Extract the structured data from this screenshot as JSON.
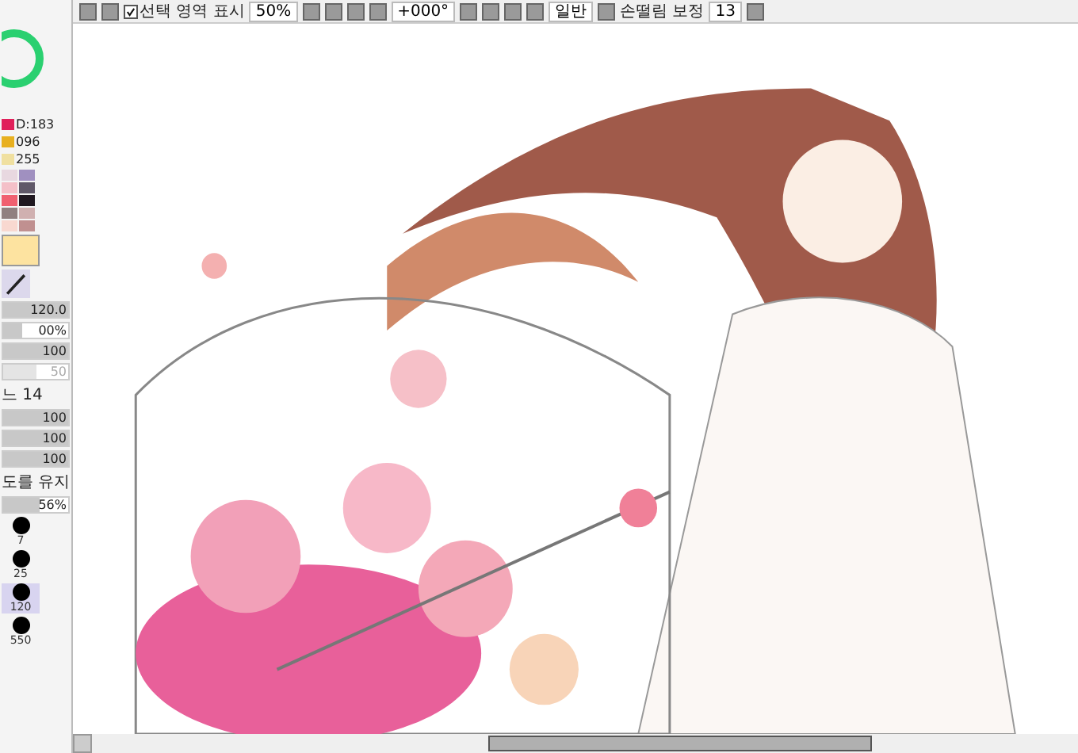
{
  "toolbar": {
    "selection_display": {
      "label": "선택 영역 표시",
      "checked": true
    },
    "zoom": "50%",
    "rotation": "+000°",
    "blend_mode": "일반",
    "stabilizer": {
      "label": "손떨림 보정",
      "value": "13"
    }
  },
  "color_values": [
    {
      "text": "D:183",
      "color": "#e0205a"
    },
    {
      "text": "096",
      "color": "#e8b020"
    },
    {
      "text": "255",
      "color": "#f0e0a0"
    }
  ],
  "tool_settings": [
    {
      "kind": "slider",
      "text": "120.0",
      "level": 1,
      "disabled": false
    },
    {
      "kind": "slider",
      "text": "00%",
      "level": 0.3,
      "disabled": false
    },
    {
      "kind": "slider",
      "text": "100",
      "level": 1,
      "disabled": false
    },
    {
      "kind": "slider",
      "text": "50",
      "level": 0.5,
      "disabled": true
    },
    {
      "kind": "label",
      "text": "느 14"
    },
    {
      "kind": "slider",
      "text": "100",
      "level": 1,
      "disabled": false
    },
    {
      "kind": "slider",
      "text": "100",
      "level": 1,
      "disabled": false
    },
    {
      "kind": "slider",
      "text": "100",
      "level": 1,
      "disabled": false
    },
    {
      "kind": "label",
      "text": "도를 유지"
    },
    {
      "kind": "slider",
      "text": "56%",
      "level": 0.56,
      "disabled": false
    }
  ],
  "brush_sizes": [
    {
      "label": "7",
      "selected": false
    },
    {
      "label": "25",
      "selected": false
    },
    {
      "label": "120",
      "selected": true
    },
    {
      "label": "550",
      "selected": false
    }
  ]
}
